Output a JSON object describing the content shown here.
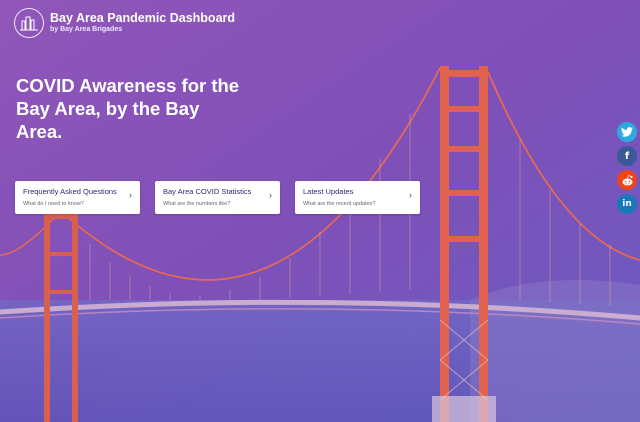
{
  "header": {
    "title": "Bay Area Pandemic Dashboard",
    "subtitle": "by Bay Area Brigades"
  },
  "hero": {
    "headline": "COVID Awareness for the Bay Area, by the Bay Area."
  },
  "cards": [
    {
      "title": "Frequently Asked Questions",
      "subtitle": "What do I need to know?",
      "chevron": "›"
    },
    {
      "title": "Bay Area COVID Statistics",
      "subtitle": "What are the numbers like?",
      "chevron": "›"
    },
    {
      "title": "Latest Updates",
      "subtitle": "What are the recent updates?",
      "chevron": "›"
    }
  ],
  "social": [
    {
      "icon": "twitter-icon",
      "glyph": "🐦",
      "color": "#2da8e0"
    },
    {
      "icon": "facebook-icon",
      "glyph": "f",
      "color": "#3b5998"
    },
    {
      "icon": "reddit-icon",
      "glyph": "r",
      "color": "#f04518"
    },
    {
      "icon": "linkedin-icon",
      "glyph": "in",
      "color": "#1779b9"
    }
  ],
  "colors": {
    "background": "#7f4fb6",
    "bridge": "#e0624f",
    "card_title": "#2d2a6e"
  }
}
